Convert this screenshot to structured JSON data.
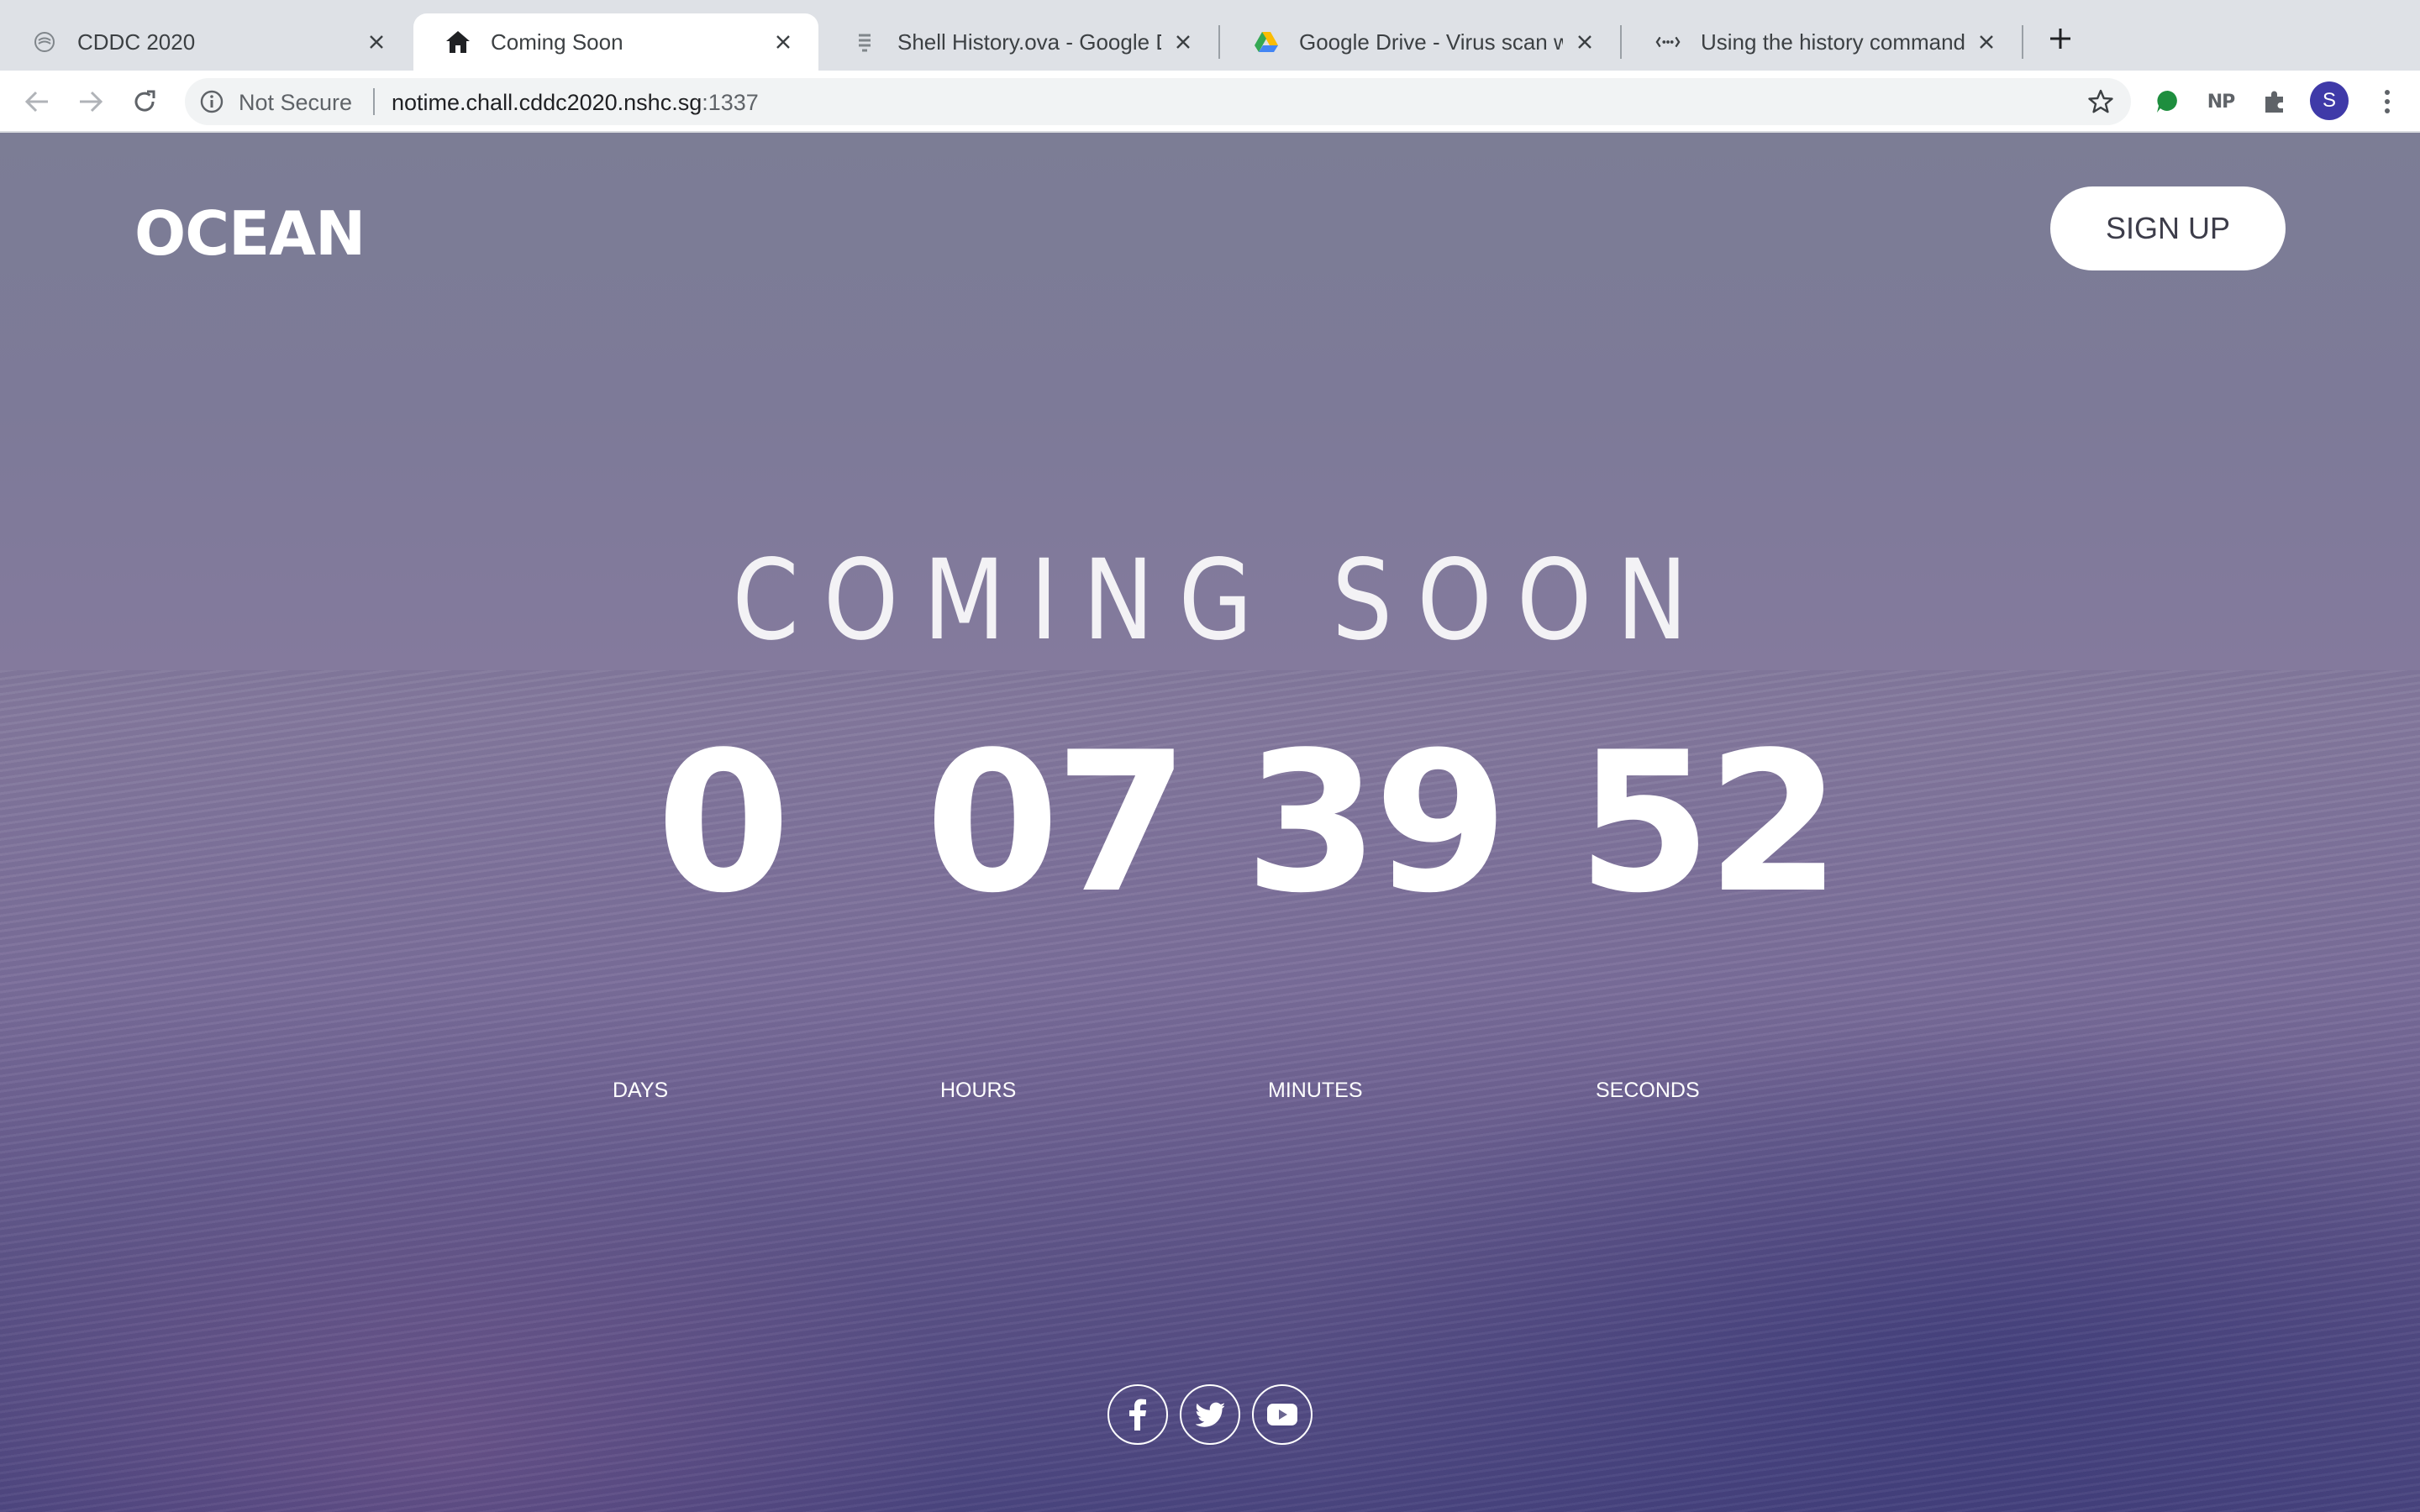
{
  "browser": {
    "tabs": [
      {
        "title": "CDDC 2020",
        "icon": "site-icon",
        "active": false
      },
      {
        "title": "Coming Soon",
        "icon": "home-icon",
        "active": true
      },
      {
        "title": "Shell History.ova - Google Drive",
        "icon": "file-icon",
        "active": false
      },
      {
        "title": "Google Drive - Virus scan warning",
        "icon": "google-drive-icon",
        "active": false
      },
      {
        "title": "Using the history command - M",
        "icon": "link-icon",
        "active": false
      }
    ],
    "new_tab_label": "+",
    "address": {
      "security_label": "Not Secure",
      "host": "notime.chall.cddc2020.nshc.sg",
      "port": ":1337"
    },
    "extensions": {
      "np_label": "NP"
    },
    "profile_initial": "S",
    "accent_color": "#3f3aa8"
  },
  "page": {
    "logo": "OCEAN",
    "signup_label": "SIGN UP",
    "heading": "COMING SOON",
    "countdown": {
      "days": {
        "value": "0",
        "label": "DAYS"
      },
      "hours": {
        "value": "07",
        "label": "HOURS"
      },
      "minutes": {
        "value": "39",
        "label": "MINUTES"
      },
      "seconds": {
        "value": "52",
        "label": "SECONDS"
      }
    },
    "social_icons": [
      "facebook-icon",
      "twitter-icon",
      "youtube-icon"
    ]
  }
}
